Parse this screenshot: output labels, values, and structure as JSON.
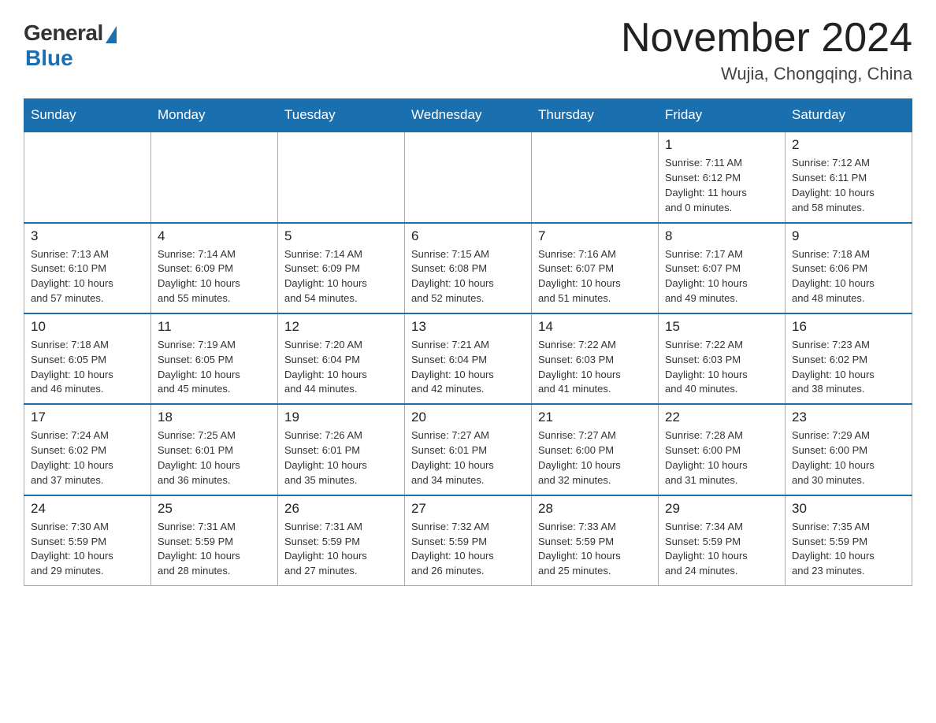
{
  "header": {
    "logo_general": "General",
    "logo_blue": "Blue",
    "month_title": "November 2024",
    "location": "Wujia, Chongqing, China"
  },
  "weekdays": [
    "Sunday",
    "Monday",
    "Tuesday",
    "Wednesday",
    "Thursday",
    "Friday",
    "Saturday"
  ],
  "weeks": [
    [
      {
        "day": "",
        "info": "",
        "empty": true
      },
      {
        "day": "",
        "info": "",
        "empty": true
      },
      {
        "day": "",
        "info": "",
        "empty": true
      },
      {
        "day": "",
        "info": "",
        "empty": true
      },
      {
        "day": "",
        "info": "",
        "empty": true
      },
      {
        "day": "1",
        "info": "Sunrise: 7:11 AM\nSunset: 6:12 PM\nDaylight: 11 hours\nand 0 minutes."
      },
      {
        "day": "2",
        "info": "Sunrise: 7:12 AM\nSunset: 6:11 PM\nDaylight: 10 hours\nand 58 minutes."
      }
    ],
    [
      {
        "day": "3",
        "info": "Sunrise: 7:13 AM\nSunset: 6:10 PM\nDaylight: 10 hours\nand 57 minutes."
      },
      {
        "day": "4",
        "info": "Sunrise: 7:14 AM\nSunset: 6:09 PM\nDaylight: 10 hours\nand 55 minutes."
      },
      {
        "day": "5",
        "info": "Sunrise: 7:14 AM\nSunset: 6:09 PM\nDaylight: 10 hours\nand 54 minutes."
      },
      {
        "day": "6",
        "info": "Sunrise: 7:15 AM\nSunset: 6:08 PM\nDaylight: 10 hours\nand 52 minutes."
      },
      {
        "day": "7",
        "info": "Sunrise: 7:16 AM\nSunset: 6:07 PM\nDaylight: 10 hours\nand 51 minutes."
      },
      {
        "day": "8",
        "info": "Sunrise: 7:17 AM\nSunset: 6:07 PM\nDaylight: 10 hours\nand 49 minutes."
      },
      {
        "day": "9",
        "info": "Sunrise: 7:18 AM\nSunset: 6:06 PM\nDaylight: 10 hours\nand 48 minutes."
      }
    ],
    [
      {
        "day": "10",
        "info": "Sunrise: 7:18 AM\nSunset: 6:05 PM\nDaylight: 10 hours\nand 46 minutes."
      },
      {
        "day": "11",
        "info": "Sunrise: 7:19 AM\nSunset: 6:05 PM\nDaylight: 10 hours\nand 45 minutes."
      },
      {
        "day": "12",
        "info": "Sunrise: 7:20 AM\nSunset: 6:04 PM\nDaylight: 10 hours\nand 44 minutes."
      },
      {
        "day": "13",
        "info": "Sunrise: 7:21 AM\nSunset: 6:04 PM\nDaylight: 10 hours\nand 42 minutes."
      },
      {
        "day": "14",
        "info": "Sunrise: 7:22 AM\nSunset: 6:03 PM\nDaylight: 10 hours\nand 41 minutes."
      },
      {
        "day": "15",
        "info": "Sunrise: 7:22 AM\nSunset: 6:03 PM\nDaylight: 10 hours\nand 40 minutes."
      },
      {
        "day": "16",
        "info": "Sunrise: 7:23 AM\nSunset: 6:02 PM\nDaylight: 10 hours\nand 38 minutes."
      }
    ],
    [
      {
        "day": "17",
        "info": "Sunrise: 7:24 AM\nSunset: 6:02 PM\nDaylight: 10 hours\nand 37 minutes."
      },
      {
        "day": "18",
        "info": "Sunrise: 7:25 AM\nSunset: 6:01 PM\nDaylight: 10 hours\nand 36 minutes."
      },
      {
        "day": "19",
        "info": "Sunrise: 7:26 AM\nSunset: 6:01 PM\nDaylight: 10 hours\nand 35 minutes."
      },
      {
        "day": "20",
        "info": "Sunrise: 7:27 AM\nSunset: 6:01 PM\nDaylight: 10 hours\nand 34 minutes."
      },
      {
        "day": "21",
        "info": "Sunrise: 7:27 AM\nSunset: 6:00 PM\nDaylight: 10 hours\nand 32 minutes."
      },
      {
        "day": "22",
        "info": "Sunrise: 7:28 AM\nSunset: 6:00 PM\nDaylight: 10 hours\nand 31 minutes."
      },
      {
        "day": "23",
        "info": "Sunrise: 7:29 AM\nSunset: 6:00 PM\nDaylight: 10 hours\nand 30 minutes."
      }
    ],
    [
      {
        "day": "24",
        "info": "Sunrise: 7:30 AM\nSunset: 5:59 PM\nDaylight: 10 hours\nand 29 minutes."
      },
      {
        "day": "25",
        "info": "Sunrise: 7:31 AM\nSunset: 5:59 PM\nDaylight: 10 hours\nand 28 minutes."
      },
      {
        "day": "26",
        "info": "Sunrise: 7:31 AM\nSunset: 5:59 PM\nDaylight: 10 hours\nand 27 minutes."
      },
      {
        "day": "27",
        "info": "Sunrise: 7:32 AM\nSunset: 5:59 PM\nDaylight: 10 hours\nand 26 minutes."
      },
      {
        "day": "28",
        "info": "Sunrise: 7:33 AM\nSunset: 5:59 PM\nDaylight: 10 hours\nand 25 minutes."
      },
      {
        "day": "29",
        "info": "Sunrise: 7:34 AM\nSunset: 5:59 PM\nDaylight: 10 hours\nand 24 minutes."
      },
      {
        "day": "30",
        "info": "Sunrise: 7:35 AM\nSunset: 5:59 PM\nDaylight: 10 hours\nand 23 minutes."
      }
    ]
  ]
}
